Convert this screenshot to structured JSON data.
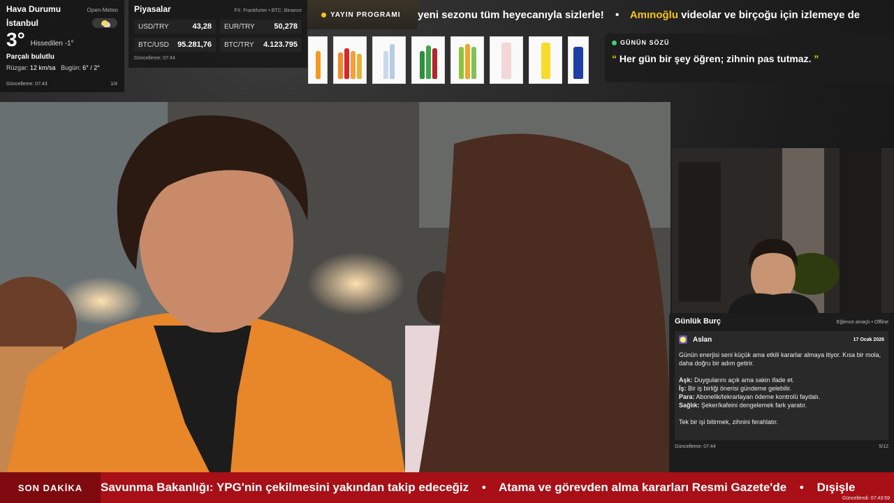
{
  "weather": {
    "title": "Hava Durumu",
    "source": "Open-Meteo",
    "city": "İstanbul",
    "temp": "3°",
    "feels": "Hissedilen -1°",
    "condition": "Parçalı bulutlu",
    "wind_label": "Rüzgar:",
    "wind_value": "12 km/sa",
    "today_label": "Bugün:",
    "today_value": "6° / 2°",
    "updated": "Güncelleme: 07:43",
    "page": "1/4",
    "icon": "partly-cloudy-icon"
  },
  "markets": {
    "title": "Piyasalar",
    "source": "FX: Frankfurter • BTC: Binance",
    "rows": [
      {
        "symbol": "USD/TRY",
        "value": "43,28"
      },
      {
        "symbol": "EUR/TRY",
        "value": "50,278"
      },
      {
        "symbol": "BTC/USD",
        "value": "95.281,76"
      },
      {
        "symbol": "BTC/TRY",
        "value": "4.123.795"
      }
    ],
    "updated": "Güncelleme: 07:44"
  },
  "schedule_button": "YAYIN PROGRAMI",
  "top_ticker": {
    "part1": "yeni sezonu tüm heyecanıyla sizlerle!",
    "sep": "•",
    "highlight": "Amınoğlu",
    "part2": "videolar ve birçoğu için izlemeye de"
  },
  "quote": {
    "title": "GÜNÜN SÖZÜ",
    "open": "“",
    "text": "Her gün bir şey öğren; zihnin pas tutmaz.",
    "close": "”"
  },
  "horoscope": {
    "title": "Günlük Burç",
    "status": "Eğlence amaçlı • Offline",
    "glyph": "♌",
    "sign": "Aslan",
    "date": "17 Ocak 2026",
    "intro": "Günün enerjisi seni küçük ama etkili kararlar almaya itiyor. Kısa bir mola, daha doğru bir adım getirir.",
    "love_label": "Aşk:",
    "love": "Duygularını açık ama sakin ifade et.",
    "work_label": "İş:",
    "work": "Bir iş birliği önerisi gündeme gelebilir.",
    "money_label": "Para:",
    "money": "Abonelik/tekrarlayan ödeme kontrolü faydalı.",
    "health_label": "Sağlık:",
    "health": "Şeker/kafeini dengelemek fark yaratır.",
    "tip": "Tek bir işi bitirmek, zihnini ferahlatır.",
    "updated": "Güncelleme: 07:44",
    "page": "5/12"
  },
  "breaking": {
    "label": "SON DAKİKA",
    "item1": "Savunma Bakanlığı: YPG'nin çekilmesini yakından takip edeceğiz",
    "sep": "•",
    "item2": "Atama ve görevden alma kararları Resmi Gazete'de",
    "item3": "Dışişle",
    "updated": "Güncellendi: 07:43:59"
  },
  "colors": {
    "accent_yellow": "#f5c518",
    "breaking_red": "#a80f16",
    "live_green": "#3bd16f"
  }
}
